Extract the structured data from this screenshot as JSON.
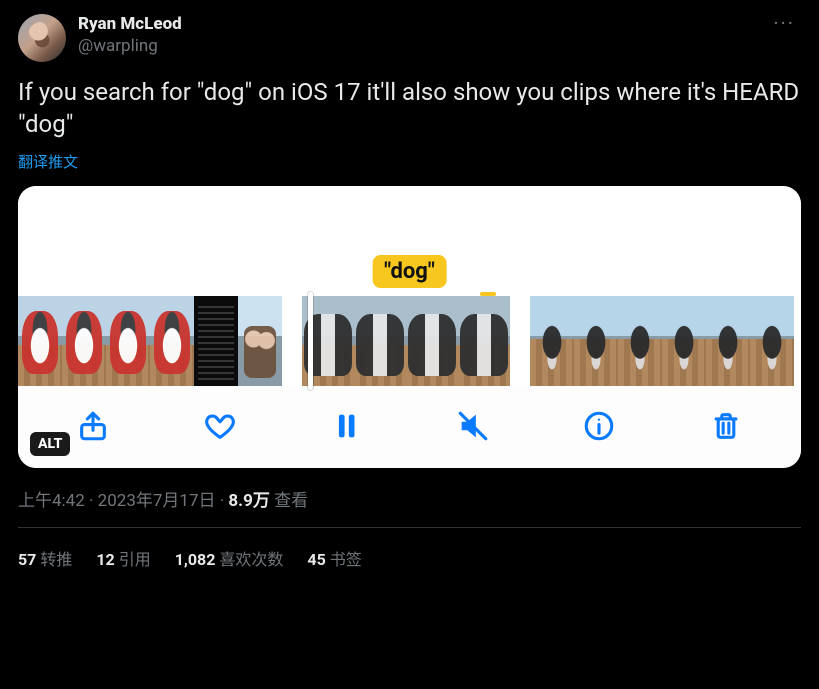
{
  "author": {
    "display_name": "Ryan McLeod",
    "handle": "@warpling"
  },
  "tweet_text": "If you search for \"dog\" on iOS 17 it'll also show you clips where it's HEARD \"dog\"",
  "translate_label": "翻译推文",
  "media": {
    "caption_tag": "\"dog\"",
    "alt_badge": "ALT"
  },
  "timestamp": {
    "time": "上午4:42",
    "date": "2023年7月17日",
    "sep": " · "
  },
  "views": {
    "count": "8.9万",
    "label": " 查看"
  },
  "stats": {
    "retweets": {
      "count": "57",
      "label": "转推"
    },
    "quotes": {
      "count": "12",
      "label": "引用"
    },
    "likes": {
      "count": "1,082",
      "label": "喜欢次数"
    },
    "bookmarks": {
      "count": "45",
      "label": "书签"
    }
  },
  "more_icon": "···"
}
